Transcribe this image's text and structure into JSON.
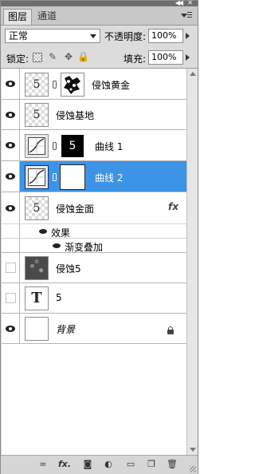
{
  "tabs": [
    {
      "label": "图层"
    },
    {
      "label": "通道"
    }
  ],
  "options": {
    "blend_mode": "正常",
    "opacity_label": "不透明度:",
    "opacity_value": "100%",
    "lock_label": "锁定:",
    "fill_label": "填充:",
    "fill_value": "100%"
  },
  "layers": [
    {
      "name": "侵蚀黄金",
      "visible": true,
      "thumb_text": "5"
    },
    {
      "name": "侵蚀基地",
      "visible": true,
      "thumb_text": "5"
    },
    {
      "name": "曲线 1",
      "visible": true,
      "mask_text": "5"
    },
    {
      "name": "曲线 2",
      "visible": true,
      "selected": true
    },
    {
      "name": "侵蚀金面",
      "visible": true,
      "thumb_text": "5",
      "fx": "fx"
    },
    {
      "name": "侵蚀5",
      "visible": false
    },
    {
      "name": "5",
      "visible": false,
      "thumb_text": "T"
    },
    {
      "name": "背景",
      "visible": true,
      "locked": true
    }
  ],
  "effects": {
    "label": "效果",
    "items": [
      {
        "label": "渐变叠加"
      }
    ]
  },
  "bottom_icons": [
    "link-layers-icon",
    "layer-style-icon",
    "add-mask-icon",
    "adjustment-layer-icon",
    "group-folder-icon",
    "new-layer-icon",
    "trash-icon"
  ]
}
